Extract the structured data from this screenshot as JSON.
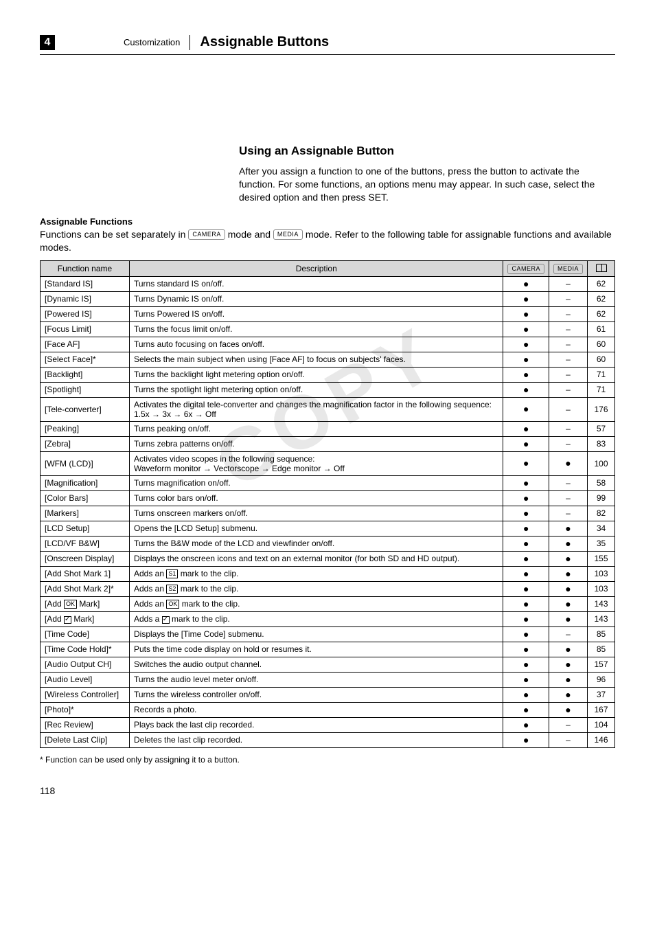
{
  "header": {
    "section_number": "4",
    "section_label": "Customization",
    "page_title": "Assignable Buttons"
  },
  "section": {
    "subheading": "Using an Assignable Button",
    "body": "After you assign a function to one of the buttons, press the button to activate the function. For some functions, an options menu may appear. In such case, select the desired option and then press SET."
  },
  "assignable": {
    "label": "Assignable Functions",
    "desc_pre": "Functions can be set separately in ",
    "mode_camera": "CAMERA",
    "desc_mid": " mode and ",
    "mode_media": "MEDIA",
    "desc_post": " mode. Refer to the following table for assignable functions and available modes."
  },
  "table": {
    "headers": {
      "fn": "Function name",
      "desc": "Description",
      "cam": "CAMERA",
      "med": "MEDIA",
      "pg_icon": "book"
    },
    "rows": [
      {
        "fn": "[Standard IS]",
        "desc": "Turns standard IS on/off.",
        "cam": "●",
        "med": "–",
        "pg": "62"
      },
      {
        "fn": "[Dynamic IS]",
        "desc": "Turns Dynamic IS on/off.",
        "cam": "●",
        "med": "–",
        "pg": "62"
      },
      {
        "fn": "[Powered IS]",
        "desc": "Turns Powered IS on/off.",
        "cam": "●",
        "med": "–",
        "pg": "62"
      },
      {
        "fn": "[Focus Limit]",
        "desc": "Turns the focus limit on/off.",
        "cam": "●",
        "med": "–",
        "pg": "61"
      },
      {
        "fn": "[Face AF]",
        "desc": "Turns auto focusing on faces on/off.",
        "cam": "●",
        "med": "–",
        "pg": "60"
      },
      {
        "fn": "[Select Face]*",
        "desc": "Selects the main subject when using [Face AF] to focus on subjects' faces.",
        "cam": "●",
        "med": "–",
        "pg": "60"
      },
      {
        "fn": "[Backlight]",
        "desc": "Turns the backlight light metering option on/off.",
        "cam": "●",
        "med": "–",
        "pg": "71"
      },
      {
        "fn": "[Spotlight]",
        "desc": "Turns the spotlight light metering option on/off.",
        "cam": "●",
        "med": "–",
        "pg": "71"
      },
      {
        "fn": "[Tele-converter]",
        "desc": "Activates the digital tele-converter and changes the magnification factor in the following sequence:\n1.5x → 3x → 6x → Off",
        "cam": "●",
        "med": "–",
        "pg": "176"
      },
      {
        "fn": "[Peaking]",
        "desc": "Turns peaking on/off.",
        "cam": "●",
        "med": "–",
        "pg": "57"
      },
      {
        "fn": "[Zebra]",
        "desc": "Turns zebra patterns on/off.",
        "cam": "●",
        "med": "–",
        "pg": "83"
      },
      {
        "fn": "[WFM (LCD)]",
        "desc": "Activates video scopes in the following sequence:\nWaveform monitor → Vectorscope → Edge monitor → Off",
        "cam": "●",
        "med": "●",
        "pg": "100"
      },
      {
        "fn": "[Magnification]",
        "desc": "Turns magnification on/off.",
        "cam": "●",
        "med": "–",
        "pg": "58"
      },
      {
        "fn": "[Color Bars]",
        "desc": "Turns color bars on/off.",
        "cam": "●",
        "med": "–",
        "pg": "99"
      },
      {
        "fn": "[Markers]",
        "desc": "Turns onscreen markers on/off.",
        "cam": "●",
        "med": "–",
        "pg": "82"
      },
      {
        "fn": "[LCD Setup]",
        "desc": "Opens the [LCD Setup] submenu.",
        "cam": "●",
        "med": "●",
        "pg": "34"
      },
      {
        "fn": "[LCD/VF B&W]",
        "desc": "Turns the B&W mode of the LCD and viewfinder on/off.",
        "cam": "●",
        "med": "●",
        "pg": "35"
      },
      {
        "fn": "[Onscreen Display]",
        "desc": "Displays the onscreen icons and text on an external monitor (for both SD and HD output).",
        "cam": "●",
        "med": "●",
        "pg": "155"
      },
      {
        "fn": "[Add Shot Mark 1]",
        "desc_html": "Adds an <span class='inline-box'>S1</span> mark to the clip.",
        "cam": "●",
        "med": "●",
        "pg": "103"
      },
      {
        "fn": "[Add Shot Mark 2]*",
        "desc_html": "Adds an <span class='inline-box'>S2</span> mark to the clip.",
        "cam": "●",
        "med": "●",
        "pg": "103"
      },
      {
        "fn": "[Add OK Mark]",
        "fn_html": "[Add <span class='inline-box'>OK</span> Mark]",
        "desc_html": "Adds an <span class='inline-box'>OK</span> mark to the clip.",
        "cam": "●",
        "med": "●",
        "pg": "143"
      },
      {
        "fn": "[Add Check Mark]",
        "fn_html": "[Add <span class='check-box'></span> Mark]",
        "desc_html": "Adds a <span class='check-box'></span> mark to the clip.",
        "cam": "●",
        "med": "●",
        "pg": "143"
      },
      {
        "fn": "[Time Code]",
        "desc": "Displays the [Time Code] submenu.",
        "cam": "●",
        "med": "–",
        "pg": "85"
      },
      {
        "fn": "[Time Code Hold]*",
        "desc": "Puts the time code display on hold or resumes it.",
        "cam": "●",
        "med": "●",
        "pg": "85"
      },
      {
        "fn": "[Audio Output CH]",
        "desc": "Switches the audio output channel.",
        "cam": "●",
        "med": "●",
        "pg": "157"
      },
      {
        "fn": "[Audio Level]",
        "desc": "Turns the audio level meter on/off.",
        "cam": "●",
        "med": "●",
        "pg": "96"
      },
      {
        "fn": "[Wireless Controller]",
        "desc": "Turns the wireless controller on/off.",
        "cam": "●",
        "med": "●",
        "pg": "37"
      },
      {
        "fn": "[Photo]*",
        "desc": "Records a photo.",
        "cam": "●",
        "med": "●",
        "pg": "167"
      },
      {
        "fn": "[Rec Review]",
        "desc": "Plays back the last clip recorded.",
        "cam": "●",
        "med": "–",
        "pg": "104"
      },
      {
        "fn": "[Delete Last Clip]",
        "desc": "Deletes the last clip recorded.",
        "cam": "●",
        "med": "–",
        "pg": "146"
      }
    ]
  },
  "footnote": "* Function can be used only by assigning it to a button.",
  "page_number": "118",
  "watermark": "COPY"
}
